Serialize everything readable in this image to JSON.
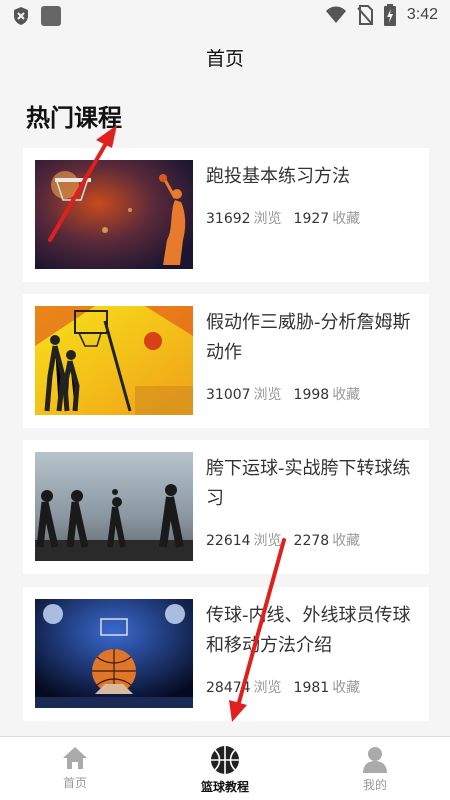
{
  "status_bar": {
    "time": "3:42",
    "icons": [
      "shield-icon",
      "app-square-icon",
      "wifi-icon",
      "no-sim-icon",
      "battery-charging-icon"
    ]
  },
  "header": {
    "title": "首页"
  },
  "section": {
    "title": "热门课程"
  },
  "courses": [
    {
      "title": "跑投基本练习方法",
      "views": "31692",
      "views_label": "浏览",
      "favorites": "1927",
      "favorites_label": "收藏"
    },
    {
      "title": "假动作三威胁-分析詹姆斯动作",
      "views": "31007",
      "views_label": "浏览",
      "favorites": "1998",
      "favorites_label": "收藏"
    },
    {
      "title": "胯下运球-实战胯下转球练习",
      "views": "22614",
      "views_label": "浏览",
      "favorites": "2278",
      "favorites_label": "收藏"
    },
    {
      "title": "传球-内线、外线球员传球和移动方法介绍",
      "views": "28474",
      "views_label": "浏览",
      "favorites": "1981",
      "favorites_label": "收藏"
    }
  ],
  "tabs": [
    {
      "label": "首页",
      "icon": "home-icon",
      "active": false
    },
    {
      "label": "篮球教程",
      "icon": "basketball-icon",
      "active": true
    },
    {
      "label": "我的",
      "icon": "user-icon",
      "active": false
    }
  ],
  "colors": {
    "annotation_arrow": "#e0201c",
    "background": "#f5f5f5",
    "card": "#ffffff"
  }
}
